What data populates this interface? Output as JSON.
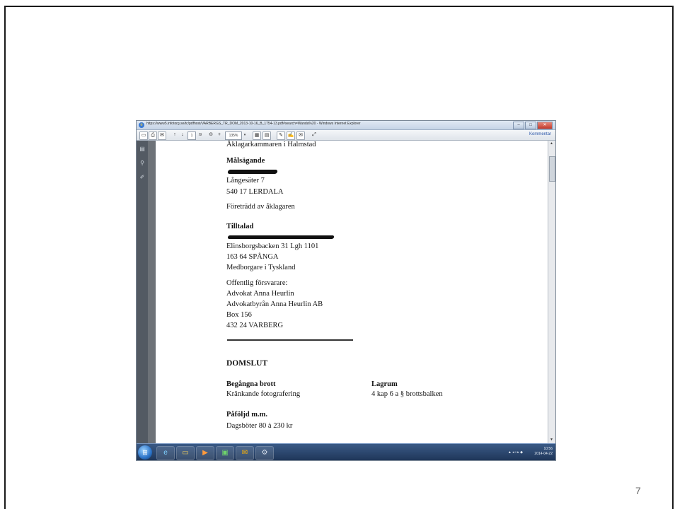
{
  "slide": {
    "number": "7"
  },
  "browser": {
    "title": "https://www5.infotorg.se/tc/pdfhost/VARBERGS_TR_DOM_2013-10-16_B_1754-13.pdf#search=Wanda%20 - Windows Internet Explorer",
    "toolbar": {
      "page_current": "1",
      "page_total": "/9",
      "zoom": "135%",
      "comment_label": "Kommentar"
    },
    "window_buttons": {
      "minimize": "–",
      "maximize": "□",
      "close": "✕"
    }
  },
  "document": {
    "prosecutor_line": "Åklagarkammaren i Halmstad",
    "plaintiff_heading": "Målsägande",
    "plaintiff_address_1": "Långesäter 7",
    "plaintiff_address_2": "540 17 LERDALA",
    "plaintiff_represented": "Företrädd av åklagaren",
    "defendant_heading": "Tilltalad",
    "defendant_address_1": "Elinsborgsbacken 31 Lgh 1101",
    "defendant_address_2": "163 64 SPÅNGA",
    "defendant_citizenship": "Medborgare i Tyskland",
    "defender_heading": "Offentlig försvarare:",
    "defender_name": "Advokat Anna Heurlin",
    "defender_firm": "Advokatbyrån Anna Heurlin AB",
    "defender_box": "Box 156",
    "defender_city": "432 24 VARBERG",
    "verdict_heading": "DOMSLUT",
    "crimes_heading": "Begångna brott",
    "crime": "Kränkande fotografering",
    "law_heading": "Lagrum",
    "law": "4 kap 6 a § brottsbalken",
    "sanction_heading": "Påföljd m.m.",
    "sanction": "Dagsböter 80 à 230 kr"
  },
  "taskbar": {
    "clock_time": "10:56",
    "clock_date": "2014-04-22"
  }
}
